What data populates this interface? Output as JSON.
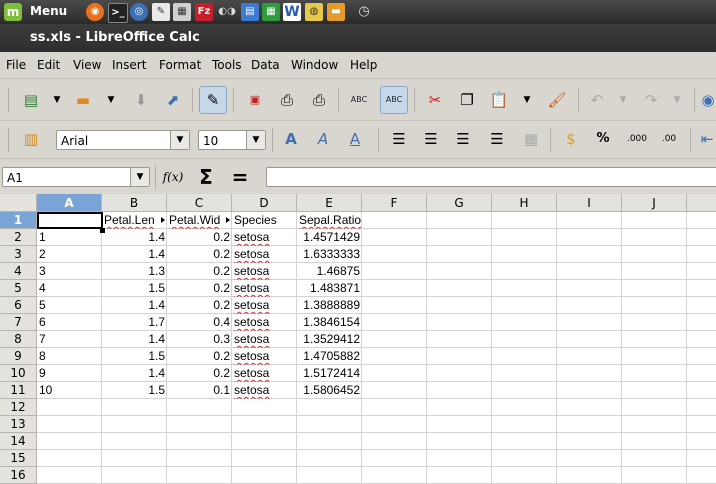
{
  "system_panel": {
    "menu_label": "Menu",
    "menu_logo": "m"
  },
  "window": {
    "title": "ss.xls - LibreOffice Calc"
  },
  "menubar": [
    "File",
    "Edit",
    "View",
    "Insert",
    "Format",
    "Tools",
    "Data",
    "Window",
    "Help"
  ],
  "toolbar": {
    "font_name": "Arial",
    "font_size": "10",
    "percent_label": "%",
    "abc_label": "ABC"
  },
  "formula_bar": {
    "name_box": "A1",
    "function_wizard_label": "f(x)",
    "sum_label": "Σ",
    "equals_label": "=",
    "formula_value": ""
  },
  "sheet": {
    "columns": [
      "A",
      "B",
      "C",
      "D",
      "E",
      "F",
      "G",
      "H",
      "I",
      "J"
    ],
    "row_numbers": [
      "1",
      "2",
      "3",
      "4",
      "5",
      "6",
      "7",
      "8",
      "9",
      "10",
      "11",
      "12",
      "13",
      "14",
      "15",
      "16"
    ],
    "header_row": [
      "",
      "Petal.Len",
      "Petal.Wid",
      "Species",
      "Sepal.Ratio"
    ],
    "rows": [
      [
        "1",
        "1.4",
        "0.2",
        "setosa",
        "1.4571429"
      ],
      [
        "2",
        "1.4",
        "0.2",
        "setosa",
        "1.6333333"
      ],
      [
        "3",
        "1.3",
        "0.2",
        "setosa",
        "1.46875"
      ],
      [
        "4",
        "1.5",
        "0.2",
        "setosa",
        "1.483871"
      ],
      [
        "5",
        "1.4",
        "0.2",
        "setosa",
        "1.3888889"
      ],
      [
        "6",
        "1.7",
        "0.4",
        "setosa",
        "1.3846154"
      ],
      [
        "7",
        "1.4",
        "0.3",
        "setosa",
        "1.3529412"
      ],
      [
        "8",
        "1.5",
        "0.2",
        "setosa",
        "1.4705882"
      ],
      [
        "9",
        "1.4",
        "0.2",
        "setosa",
        "1.5172414"
      ],
      [
        "10",
        "1.5",
        "0.1",
        "setosa",
        "1.5806452"
      ]
    ]
  }
}
